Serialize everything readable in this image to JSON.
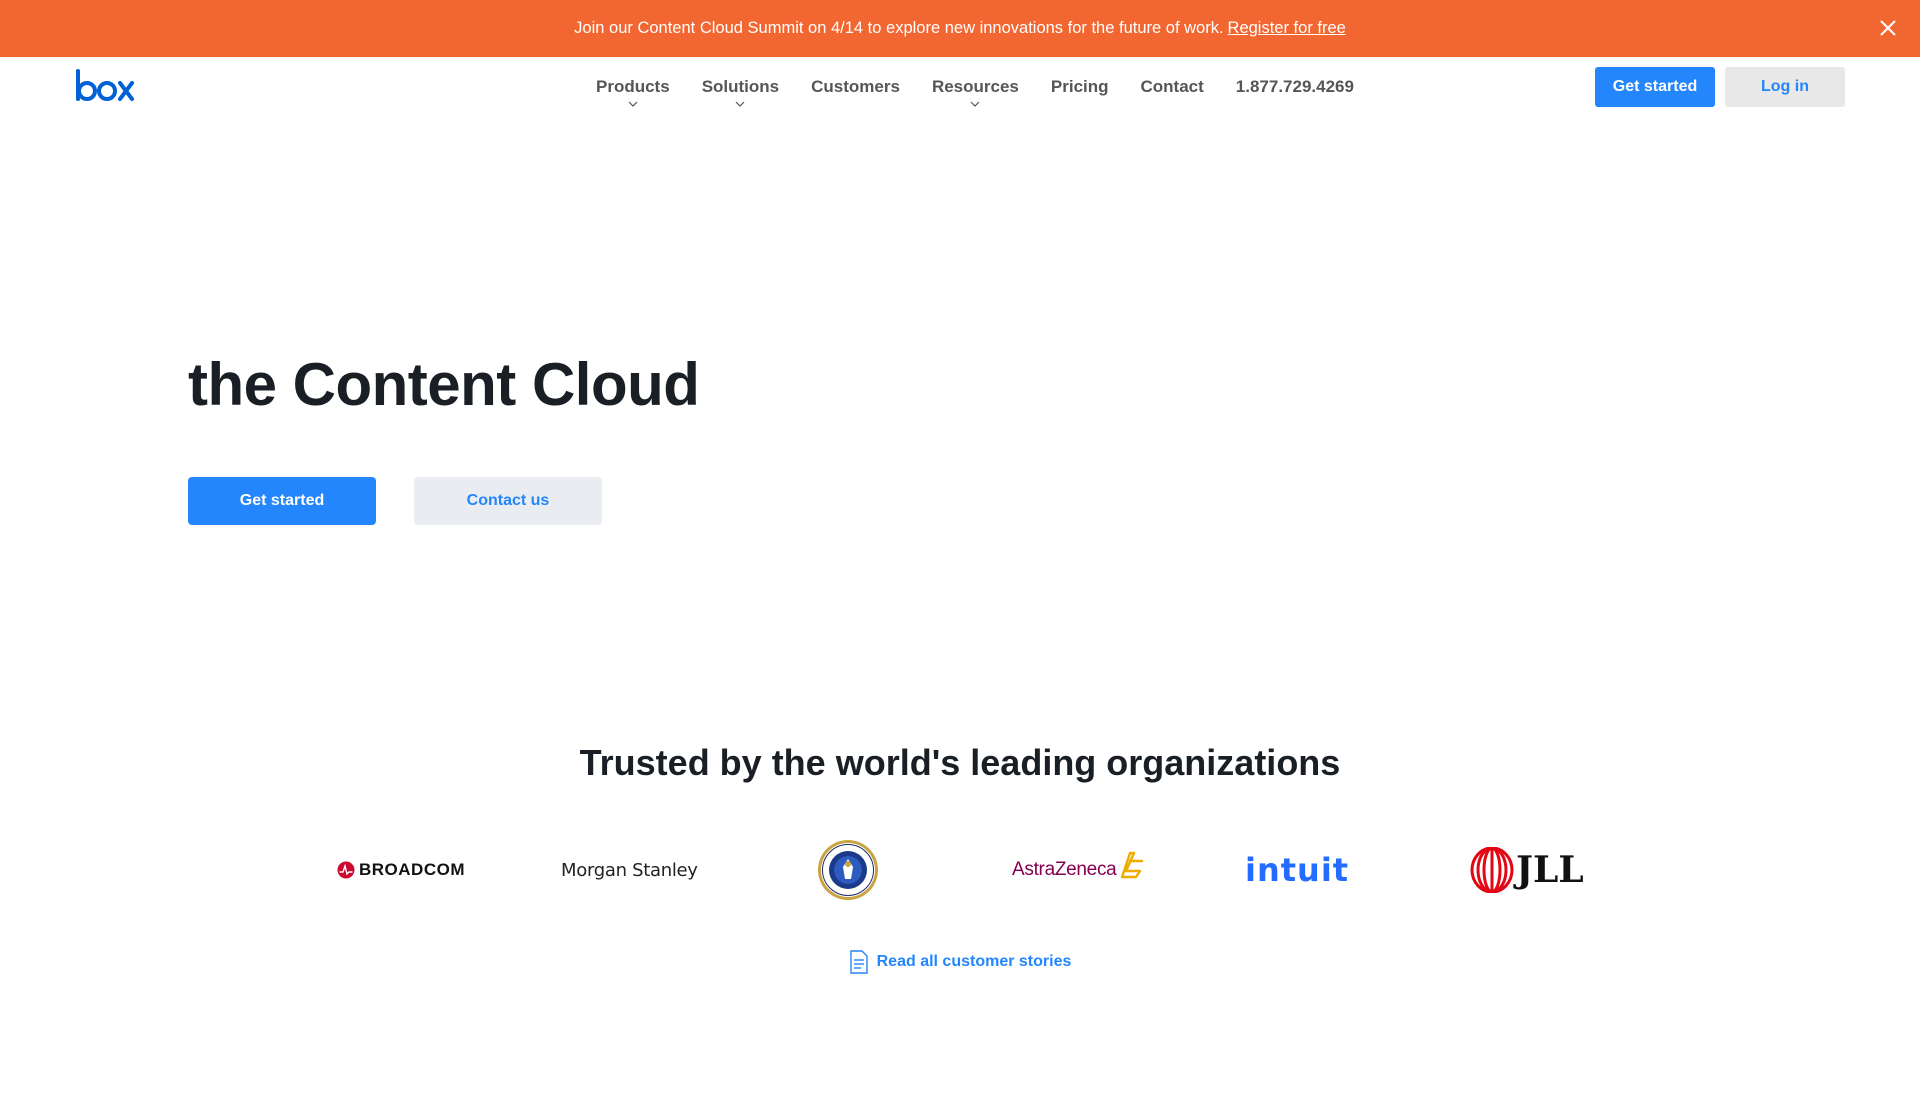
{
  "banner": {
    "message": "Join our Content Cloud Summit on 4/14 to explore new innovations for the future of work.",
    "link_label": "Register for free",
    "bg_color": "#f26631",
    "close_icon": "close-icon"
  },
  "header": {
    "logo_text": "box",
    "nav": [
      {
        "label": "Products",
        "has_dropdown": true
      },
      {
        "label": "Solutions",
        "has_dropdown": true
      },
      {
        "label": "Customers",
        "has_dropdown": false
      },
      {
        "label": "Resources",
        "has_dropdown": true
      },
      {
        "label": "Pricing",
        "has_dropdown": false
      },
      {
        "label": "Contact",
        "has_dropdown": false
      }
    ],
    "phone": "1.877.729.4269",
    "get_started_label": "Get started",
    "login_label": "Log in"
  },
  "hero": {
    "title": "the Content Cloud",
    "primary_label": "Get started",
    "secondary_label": "Contact us"
  },
  "trusted": {
    "title": "Trusted by the world's leading organizations",
    "logos": {
      "broadcom": "BROADCOM",
      "morgan_stanley": "Morgan Stanley",
      "usaf": "United States Air Force",
      "astrazeneca": "AstraZeneca",
      "intuit": "intuit",
      "jll": "JLL"
    },
    "stories_label": "Read all customer stories",
    "stories_icon": "document-icon"
  },
  "colors": {
    "accent": "#2486fc",
    "heading": "#1a1f26"
  }
}
